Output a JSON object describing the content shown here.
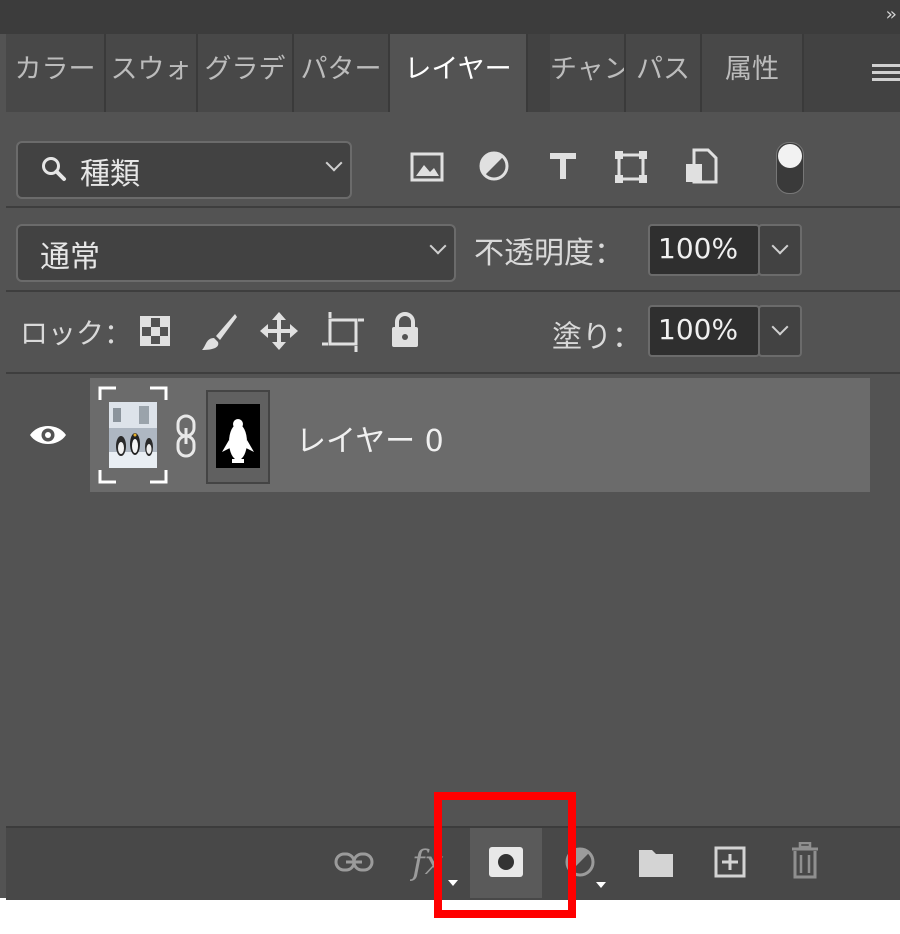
{
  "header": {
    "collapse_label": "››"
  },
  "tabs": [
    {
      "label": "カラー"
    },
    {
      "label": "スウォ"
    },
    {
      "label": "グラデ"
    },
    {
      "label": "パター"
    },
    {
      "label": "レイヤー",
      "active": true
    },
    {
      "label": "チャン"
    },
    {
      "label": "パス"
    },
    {
      "label": "属性"
    }
  ],
  "filter": {
    "kind_label": "種類"
  },
  "blend": {
    "mode_label": "通常",
    "opacity_label": "不透明度：",
    "opacity_value": "100%"
  },
  "lock": {
    "label": "ロック：",
    "fill_label": "塗り：",
    "fill_value": "100%"
  },
  "layers": [
    {
      "name": "レイヤー 0",
      "visible": true
    }
  ],
  "colors": {
    "panel_bg": "#535353",
    "selected_row": "#6b6b6b",
    "highlight": "#ff0000"
  }
}
